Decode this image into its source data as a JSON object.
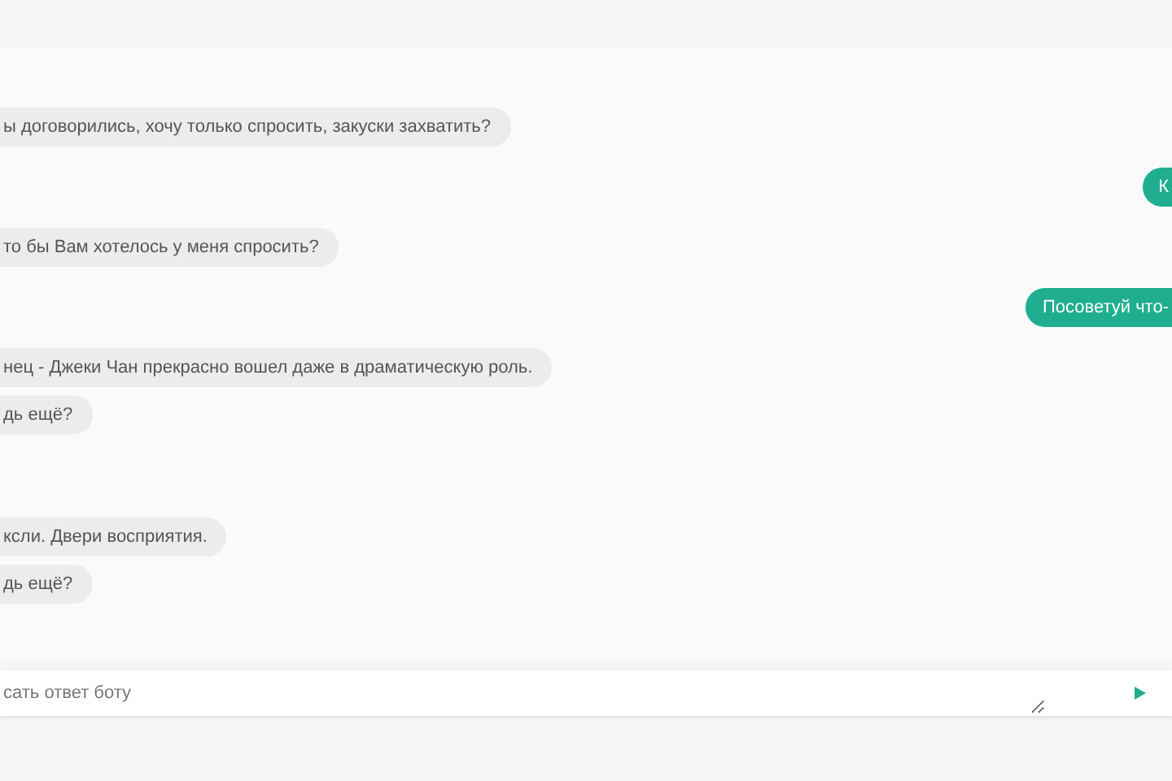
{
  "messages": [
    {
      "kind": "bot",
      "text": "ы договорились, хочу только спросить, закуски захватить?"
    },
    {
      "kind": "user",
      "text": "К"
    },
    {
      "kind": "bot",
      "text": "то бы Вам хотелось у меня спросить?"
    },
    {
      "kind": "user",
      "text": "Посоветуй что-"
    },
    {
      "kind": "bot",
      "text": "нец - Джеки Чан прекрасно вошел даже в драматическую роль."
    },
    {
      "kind": "bot",
      "text": "дь ещё?"
    },
    {
      "kind": "bot",
      "text": "ксли. Двери восприятия."
    },
    {
      "kind": "bot",
      "text": "дь ещё?"
    }
  ],
  "composer": {
    "placeholder": "сать ответ боту"
  }
}
